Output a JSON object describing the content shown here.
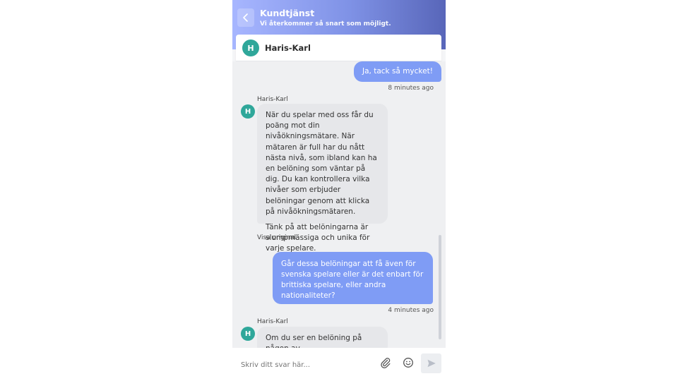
{
  "header": {
    "title": "Kundtjänst",
    "subtitle": "Vi återkommer så snart som möjligt."
  },
  "agent": {
    "initial": "H",
    "name": "Haris-Karl"
  },
  "messages": [
    {
      "type": "user",
      "text": "Ja, tack så mycket!",
      "time": "8 minutes ago"
    },
    {
      "type": "agent",
      "sender": "Haris-Karl",
      "paragraphs": [
        "När du spelar med oss får du poäng mot din nivåökningsmätare. När mätaren är full har du nått nästa nivå, som ibland kan ha en belöning som väntar på dig. Du kan kontrollera vilka nivåer som erbjuder belöningar genom att klicka på nivåökningsmätaren.",
        "Tänk på att belöningarna är slumpmässiga och unika för varje spelare."
      ],
      "link": "Visa original"
    },
    {
      "type": "user",
      "text": "Går dessa belöningar att få även för svenska spelare eller är det enbart för brittiska spelare, eller andra nationaliteter?",
      "time": "4 minutes ago"
    },
    {
      "type": "agent",
      "sender": "Haris-Karl",
      "paragraphs": [
        "Om du ser en belöning på någon av"
      ]
    }
  ],
  "composer": {
    "placeholder": "Skriv ditt svar här...",
    "icons": [
      "paperclip-icon",
      "emoji-icon",
      "send-icon"
    ]
  },
  "colors": {
    "header_start": "#a7b6ff",
    "header_end": "#5866b9",
    "user_bubble": "#7f9cf5",
    "agent_bubble": "#e6e7ea",
    "avatar": "#2fa79a"
  }
}
